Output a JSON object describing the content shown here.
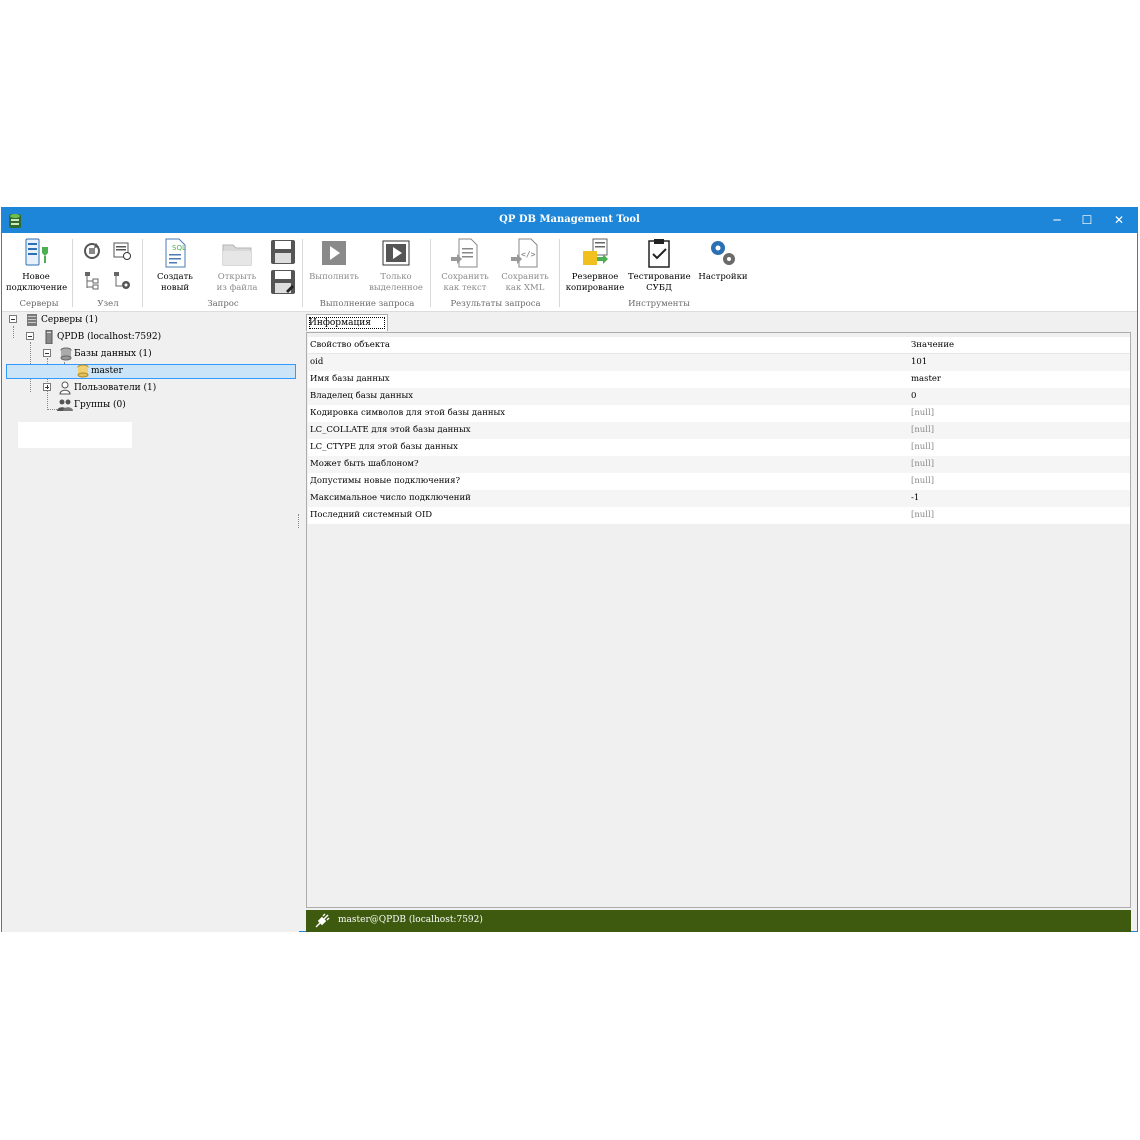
{
  "window": {
    "title": "QP DB Management Tool",
    "accent": "#1e86d8"
  },
  "ribbon": {
    "new_connection": "Новое\nподключение",
    "create_new": "Создать\nновый",
    "open_file": "Открыть\nиз файла",
    "execute": "Выполнить",
    "only_selected": "Только\nвыделенное",
    "save_text": "Сохранить\nкак текст",
    "save_xml": "Сохранить\nкак XML",
    "backup": "Резервное\nкопирование",
    "test_dbms": "Тестирование\nСУБД",
    "settings": "Настройки",
    "groups": {
      "servers": "Серверы",
      "node": "Узел",
      "query": "Запрос",
      "execution": "Выполнение запроса",
      "results": "Результаты запроса",
      "tools": "Инструменты"
    }
  },
  "tree": {
    "servers": "Серверы (1)",
    "qpdb": "QPDB (localhost:7592)",
    "databases": "Базы данных (1)",
    "master": "master",
    "users": "Пользователи (1)",
    "groups": "Группы (0)"
  },
  "info_tab": "Информация",
  "grid": {
    "col_property": "Свойство объекта",
    "col_value": "Значение",
    "rows": [
      {
        "property": "oid",
        "value": "101"
      },
      {
        "property": "Имя базы данных",
        "value": "master"
      },
      {
        "property": "Владелец базы данных",
        "value": "0"
      },
      {
        "property": "Кодировка символов для этой базы данных",
        "value": "[null]"
      },
      {
        "property": "LC_COLLATE для этой базы данных",
        "value": "[null]"
      },
      {
        "property": "LC_CTYPE для этой базы данных",
        "value": "[null]"
      },
      {
        "property": "Может быть шаблоном?",
        "value": "[null]"
      },
      {
        "property": "Допустимы новые подключения?",
        "value": "[null]"
      },
      {
        "property": "Максимальное число подключений",
        "value": "-1"
      },
      {
        "property": "Последний системный OID",
        "value": "[null]"
      }
    ]
  },
  "status": {
    "connection": "master@QPDB (localhost:7592)",
    "color": "#3d5a0f"
  }
}
